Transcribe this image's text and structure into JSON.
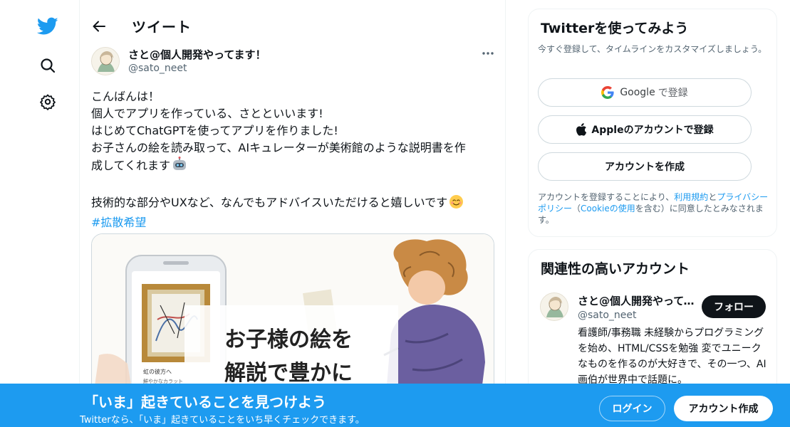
{
  "nav": {
    "icons": [
      "twitter-bird-icon",
      "search-icon",
      "gear-icon"
    ],
    "brand_color": "#1d9bf0"
  },
  "header": {
    "title": "ツイート"
  },
  "tweet": {
    "author_name": "さと@個人開発やってます！",
    "author_handle": "@sato_neet",
    "lines": [
      "こんばんは！",
      "個人でアプリを作っている、さとといいます!",
      "はじめてChatGPTを使ってアプリを作りました!",
      "お子さんの絵を読み取って、AIキュレーターが美術館のような説明書を作",
      "成してくれます"
    ],
    "line2": "技術的な部分やUXなど、なんでもアドバイスいただけると嬉しいです",
    "hashtag": "#拡散希望"
  },
  "media": {
    "headline_line1": "お子様の絵を",
    "headline_line2": "解説で豊かに",
    "phone_caption1": "虹の彼方へ",
    "phone_caption2": "鮮やかなカラット"
  },
  "signup": {
    "title": "Twitterを使ってみよう",
    "subtitle": "今すぐ登録して、タイムラインをカスタマイズしましょう。",
    "google_label": "Google",
    "google_suffix": "で登録",
    "apple_label": "Appleのアカウントで登録",
    "create_label": "アカウントを作成",
    "legal_prefix": "アカウントを登録することにより、",
    "legal_terms": "利用規約",
    "legal_and": "と",
    "legal_privacy": "プライバシーポリシー",
    "legal_paren_open": "（",
    "legal_cookie": "Cookieの使用",
    "legal_suffix": "を含む）に同意したとみなされます。"
  },
  "related": {
    "title": "関連性の高いアカウント",
    "name": "さと@個人開発やってます！",
    "handle": "@sato_neet",
    "follow_label": "フォロー",
    "bio": "看護師/事務職 未経験からプログラミングを始め、HTML/CSSを勉強 変でユニークなものを作るのが大好きで、その一つ、AI画伯が世界中で話題に。"
  },
  "bottom_bar": {
    "title": "「いま」起きていることを見つけよう",
    "subtitle": "Twitterなら、「いま」起きていることをいち早くチェックできます。",
    "login_label": "ログイン",
    "signup_label": "アカウント作成"
  }
}
